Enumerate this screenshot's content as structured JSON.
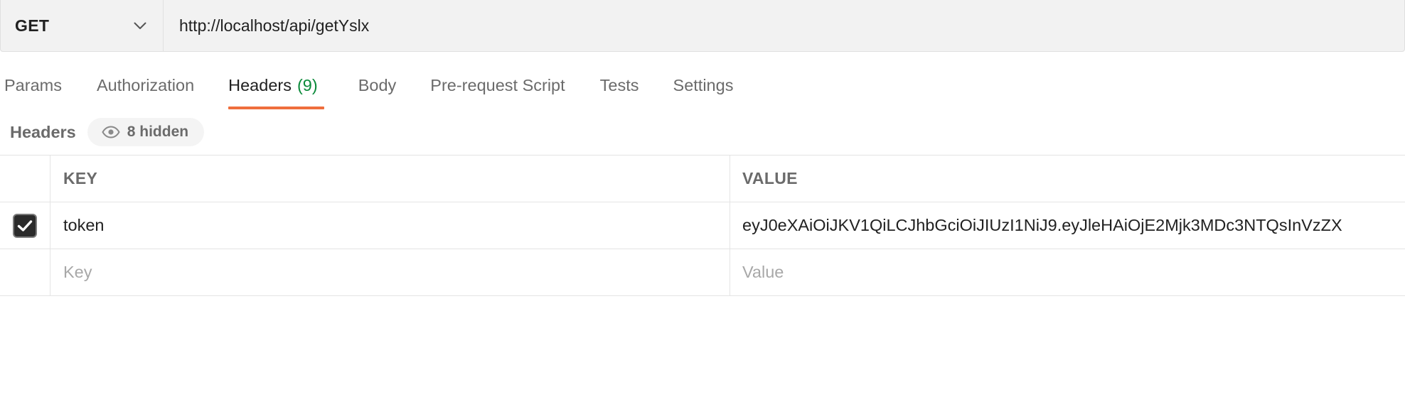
{
  "request": {
    "method": "GET",
    "url": "http://localhost/api/getYslx"
  },
  "tabs": [
    {
      "label": "Params"
    },
    {
      "label": "Authorization"
    },
    {
      "label": "Headers",
      "count": "(9)",
      "active": true
    },
    {
      "label": "Body"
    },
    {
      "label": "Pre-request Script"
    },
    {
      "label": "Tests"
    },
    {
      "label": "Settings"
    }
  ],
  "headers_panel": {
    "title": "Headers",
    "hidden_label": "8 hidden"
  },
  "table": {
    "columns": {
      "key": "KEY",
      "value": "VALUE"
    },
    "rows": [
      {
        "checked": true,
        "key": "token",
        "value": "eyJ0eXAiOiJKV1QiLCJhbGciOiJIUzI1NiJ9.eyJleHAiOjE2Mjk3MDc3NTQsInVzZX"
      }
    ],
    "new_row": {
      "key_placeholder": "Key",
      "value_placeholder": "Value"
    }
  },
  "colors": {
    "active_tab_underline": "#ef6e3c",
    "count_green": "#0b8a3a"
  },
  "icons": {
    "method_dropdown": "chevron-down-icon",
    "hidden_toggle": "eye-icon",
    "row_checkbox": "checkmark-icon"
  }
}
